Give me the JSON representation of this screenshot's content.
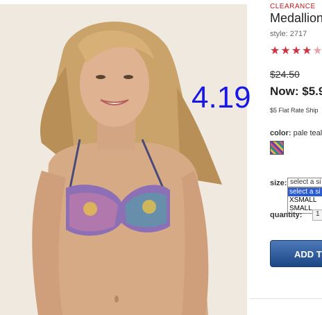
{
  "product": {
    "badge": "CLEARANCE",
    "title": "Medallion",
    "style": "style: 2717",
    "rating_stars": 4,
    "rating_max": 5,
    "was_price": "$24.50",
    "now_price": "Now: $5.9",
    "shipping": "$5 Flat Rate Ship",
    "color_label": "color:",
    "color_value": "pale teal",
    "swatch_icon": "print-swatch-icon"
  },
  "overlay": {
    "value": "4.19"
  },
  "size": {
    "label": "size:",
    "selected": "select a si",
    "options": [
      "select a si",
      "XSMALL",
      "SMALL"
    ]
  },
  "quantity": {
    "label": "quantity:",
    "value": "1"
  },
  "actions": {
    "add_label": "ADD T"
  },
  "colors": {
    "brand_red": "#c4161c",
    "button_blue": "#1c4785",
    "overlay_blue": "#1717e8"
  }
}
